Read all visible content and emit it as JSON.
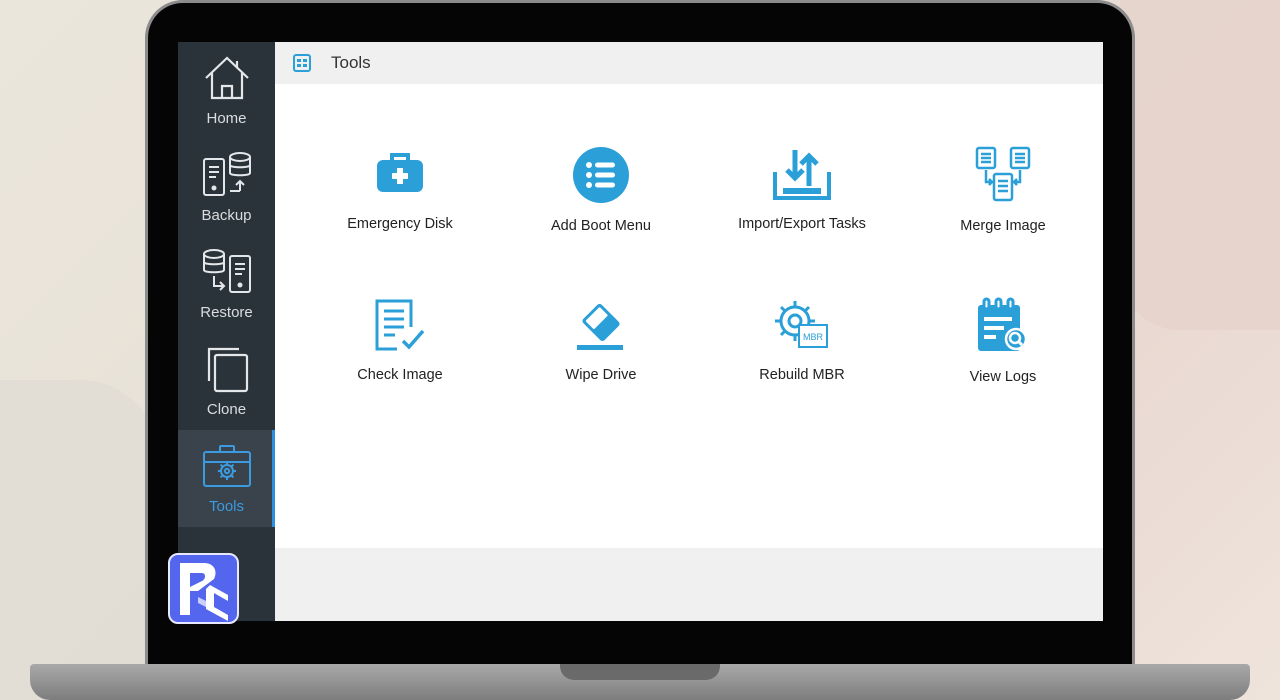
{
  "window": {
    "title": "Tools"
  },
  "sidebar": {
    "items": [
      {
        "label": "Home",
        "icon": "home-icon"
      },
      {
        "label": "Backup",
        "icon": "backup-icon"
      },
      {
        "label": "Restore",
        "icon": "restore-icon"
      },
      {
        "label": "Clone",
        "icon": "clone-icon"
      },
      {
        "label": "Tools",
        "icon": "tools-icon",
        "active": true
      }
    ]
  },
  "tools": [
    {
      "label": "Emergency Disk",
      "icon": "first-aid-kit-icon"
    },
    {
      "label": "Add Boot Menu",
      "icon": "list-menu-icon"
    },
    {
      "label": "Import/Export Tasks",
      "icon": "import-export-icon"
    },
    {
      "label": "Merge Image",
      "icon": "merge-documents-icon"
    },
    {
      "label": "Check Image",
      "icon": "check-document-icon"
    },
    {
      "label": "Wipe Drive",
      "icon": "eraser-icon"
    },
    {
      "label": "Rebuild MBR",
      "icon": "gear-mbr-icon"
    },
    {
      "label": "View Logs",
      "icon": "log-search-icon"
    }
  ],
  "mbr_badge": "MBR",
  "colors": {
    "accent": "#2a9fd8",
    "sidebar": "#2b333a",
    "sidebar_active": "#3a434b",
    "active_text": "#3a9be0",
    "brand": "#5566ee"
  }
}
